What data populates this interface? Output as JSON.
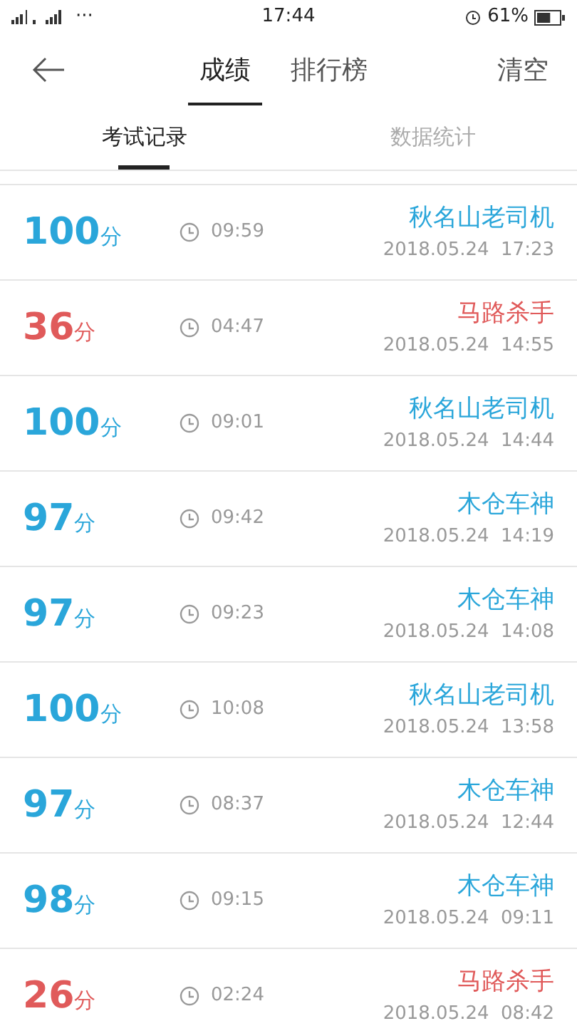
{
  "status_bar": {
    "dots": "···",
    "time": "17:44",
    "battery": "61%"
  },
  "header": {
    "tabs": [
      {
        "label": "成绩",
        "selected": true
      },
      {
        "label": "排行榜",
        "selected": false
      }
    ],
    "action": "清空"
  },
  "subtabs": [
    {
      "label": "考试记录",
      "selected": true
    },
    {
      "label": "数据统计",
      "selected": false
    }
  ],
  "records": [
    {
      "score": "100",
      "unit": "分",
      "passed": true,
      "duration": "09:59",
      "title": "秋名山老司机",
      "date": "2018.05.24  17:23"
    },
    {
      "score": "36",
      "unit": "分",
      "passed": false,
      "duration": "04:47",
      "title": "马路杀手",
      "date": "2018.05.24  14:55"
    },
    {
      "score": "100",
      "unit": "分",
      "passed": true,
      "duration": "09:01",
      "title": "秋名山老司机",
      "date": "2018.05.24  14:44"
    },
    {
      "score": "97",
      "unit": "分",
      "passed": true,
      "duration": "09:42",
      "title": "木仓车神",
      "date": "2018.05.24  14:19"
    },
    {
      "score": "97",
      "unit": "分",
      "passed": true,
      "duration": "09:23",
      "title": "木仓车神",
      "date": "2018.05.24  14:08"
    },
    {
      "score": "100",
      "unit": "分",
      "passed": true,
      "duration": "10:08",
      "title": "秋名山老司机",
      "date": "2018.05.24  13:58"
    },
    {
      "score": "97",
      "unit": "分",
      "passed": true,
      "duration": "08:37",
      "title": "木仓车神",
      "date": "2018.05.24  12:44"
    },
    {
      "score": "98",
      "unit": "分",
      "passed": true,
      "duration": "09:15",
      "title": "木仓车神",
      "date": "2018.05.24  09:11"
    },
    {
      "score": "26",
      "unit": "分",
      "passed": false,
      "duration": "02:24",
      "title": "马路杀手",
      "date": "2018.05.24  08:42"
    }
  ]
}
